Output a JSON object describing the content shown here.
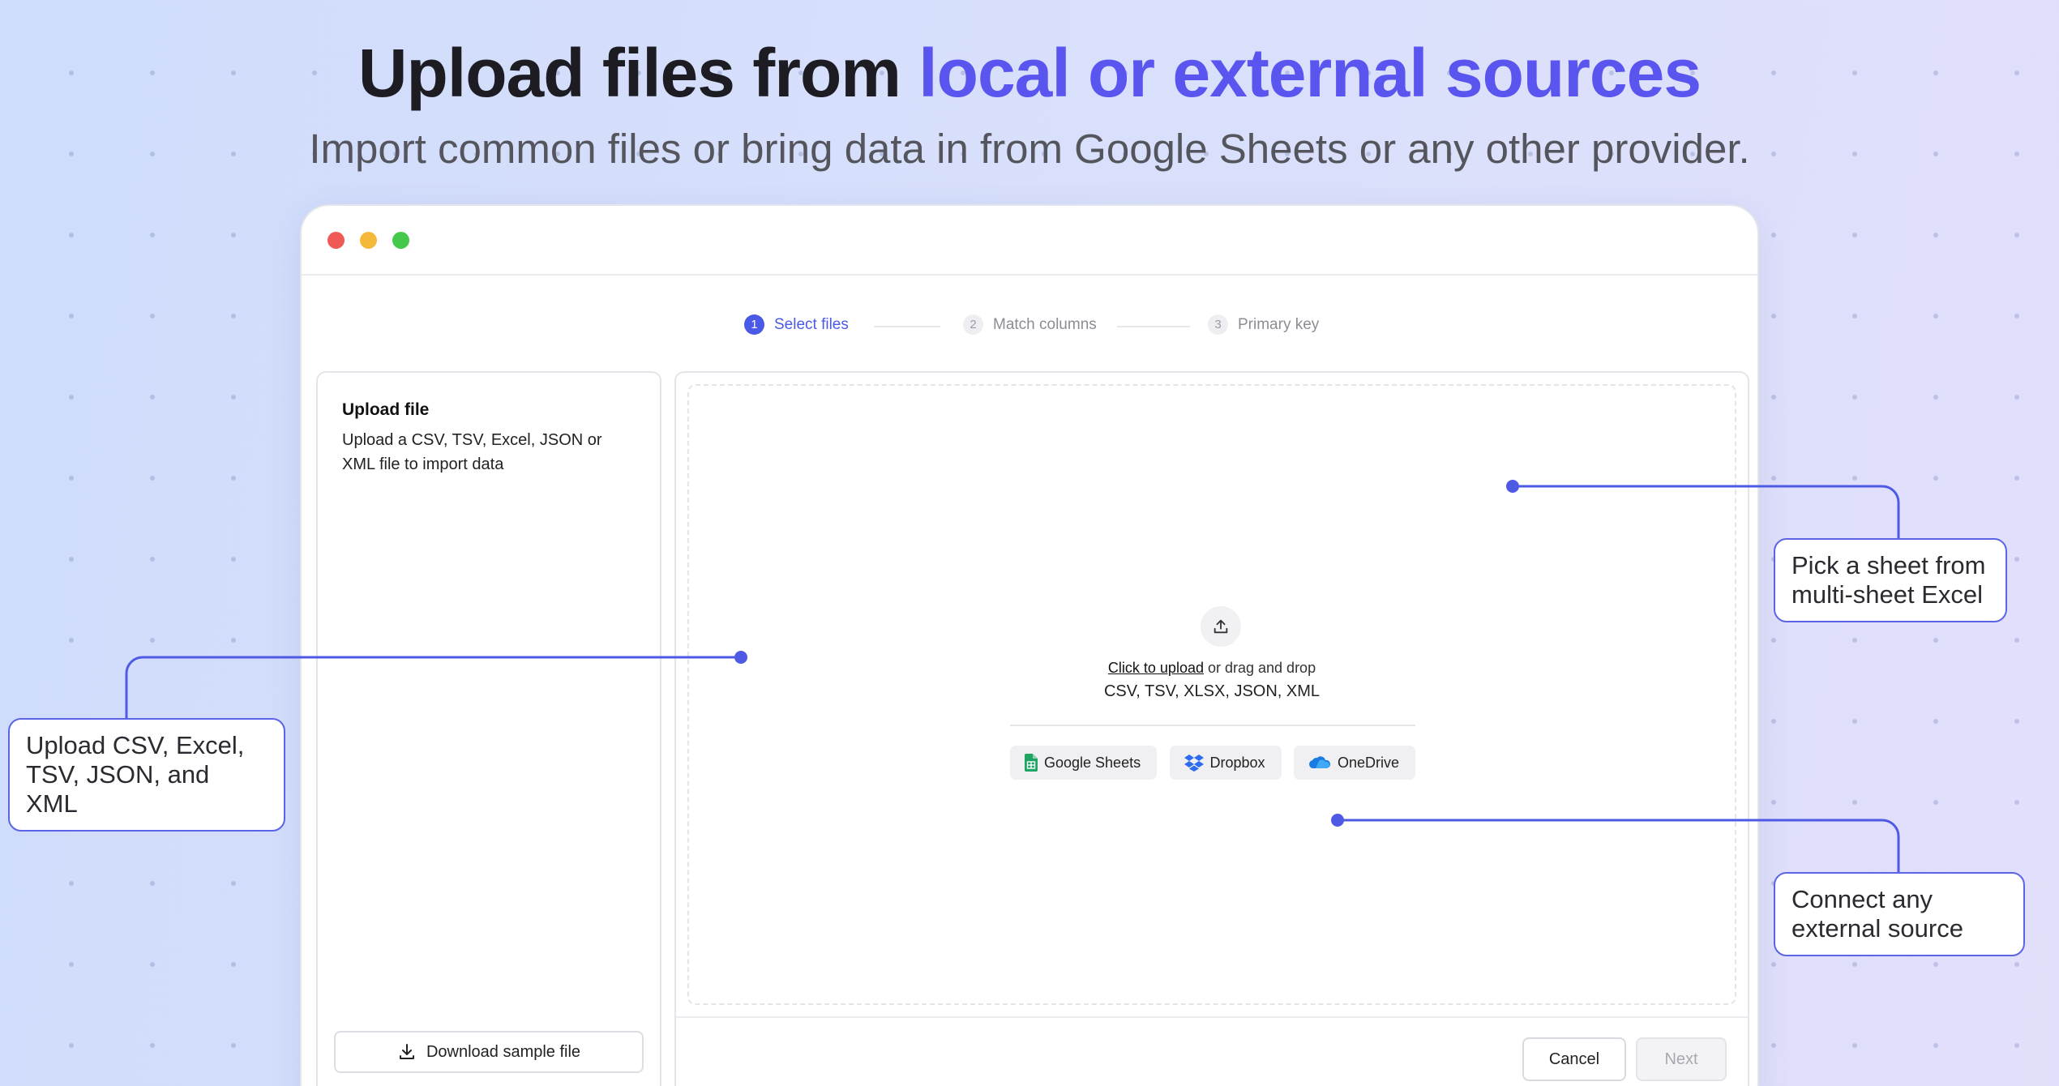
{
  "hero": {
    "title_plain": "Upload files from ",
    "title_accent": "local or external sources",
    "subtitle": "Import common files or bring data in from Google Sheets or any other provider."
  },
  "stepper": {
    "steps": [
      {
        "number": "1",
        "label": "Select files",
        "state": "active"
      },
      {
        "number": "2",
        "label": "Match columns",
        "state": "inactive"
      },
      {
        "number": "3",
        "label": "Primary key",
        "state": "inactive"
      }
    ]
  },
  "left_panel": {
    "title": "Upload file",
    "description": "Upload a CSV, TSV, Excel, JSON or XML file to import data",
    "download_label": "Download sample file"
  },
  "dropzone": {
    "cta": "Click to upload",
    "cta_rest": " or drag and drop",
    "formats": "CSV, TSV, XLSX, JSON, XML",
    "providers": [
      {
        "label": "Google Sheets",
        "icon": "google-sheets-icon"
      },
      {
        "label": "Dropbox",
        "icon": "dropbox-icon"
      },
      {
        "label": "OneDrive",
        "icon": "onedrive-icon"
      }
    ]
  },
  "footer": {
    "cancel_label": "Cancel",
    "next_label": "Next"
  },
  "callouts": {
    "upload": "Upload CSV, Excel, TSV, JSON, and XML",
    "sheet": "Pick a sheet from multi-sheet Excel",
    "connect": "Connect any external source"
  },
  "colors": {
    "accent": "#5b55f0",
    "step_active": "#4a59e6",
    "callout_border": "#5b64e6"
  }
}
